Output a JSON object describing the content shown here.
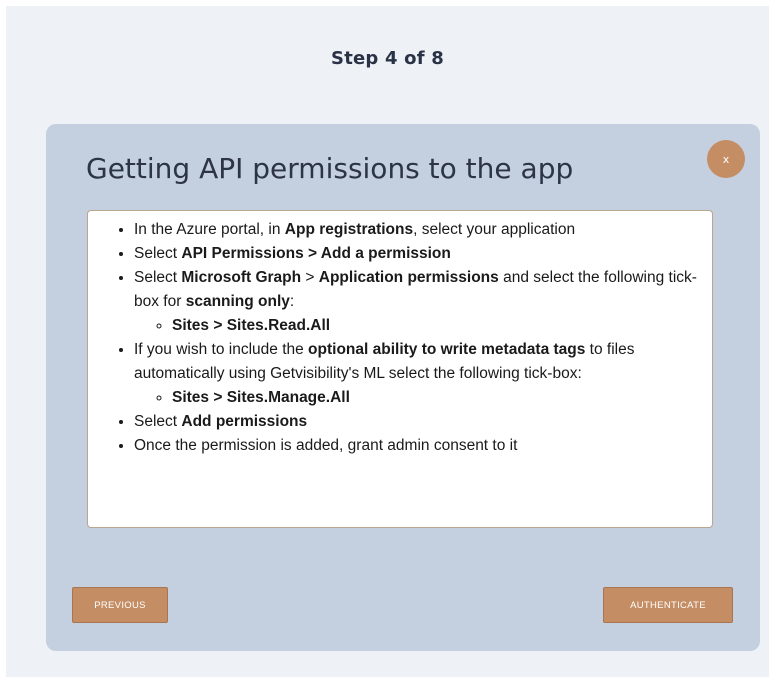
{
  "step": {
    "label": "Step 4 of  8"
  },
  "dialog": {
    "title": "Getting API permissions to the app",
    "close_label": "x",
    "steps": [
      {
        "segments": [
          {
            "text": "In the Azure portal, in ",
            "bold": false
          },
          {
            "text": "App registrations",
            "bold": true
          },
          {
            "text": ", select your application",
            "bold": false
          }
        ]
      },
      {
        "segments": [
          {
            "text": "Select ",
            "bold": false
          },
          {
            "text": "API Permissions > Add a permission",
            "bold": true
          }
        ]
      },
      {
        "segments": [
          {
            "text": "Select ",
            "bold": false
          },
          {
            "text": "Microsoft Graph",
            "bold": true
          },
          {
            "text": " > ",
            "bold": false
          },
          {
            "text": "Application permissions",
            "bold": true
          },
          {
            "text": " and select the following tick-box for ",
            "bold": false
          },
          {
            "text": "scanning only",
            "bold": true
          },
          {
            "text": ":",
            "bold": false
          }
        ],
        "sub": [
          "Sites > Sites.Read.All"
        ]
      },
      {
        "segments": [
          {
            "text": "If you wish to include the ",
            "bold": false
          },
          {
            "text": "optional ability to write metadata tags",
            "bold": true
          },
          {
            "text": " to files automatically using Getvisibility's ML select the following tick-box:",
            "bold": false
          }
        ],
        "sub": [
          "Sites > Sites.Manage.All"
        ]
      },
      {
        "segments": [
          {
            "text": "Select ",
            "bold": false
          },
          {
            "text": "Add permissions",
            "bold": true
          }
        ]
      },
      {
        "segments": [
          {
            "text": "Once the permission is added, grant admin consent to it",
            "bold": false
          }
        ]
      }
    ]
  },
  "buttons": {
    "previous": "PREVIOUS",
    "authenticate": "AUTHENTICATE"
  },
  "colors": {
    "page_background": "#eef1f6",
    "panel_background": "#c4cfdf",
    "accent": "#c48d63",
    "title_text": "#2c3446"
  }
}
